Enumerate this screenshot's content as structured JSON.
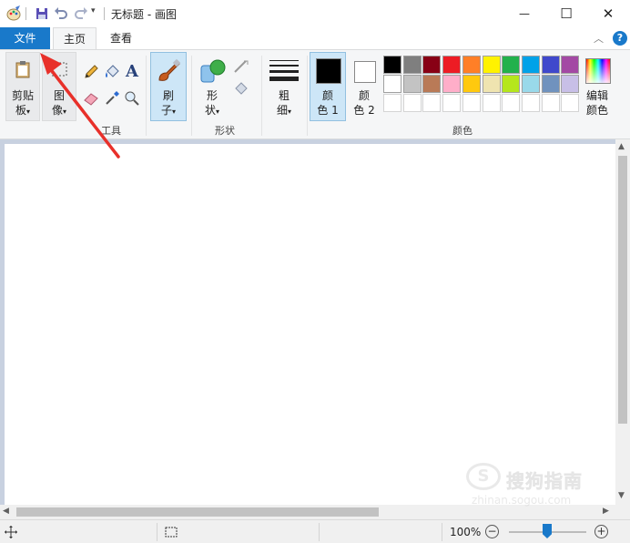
{
  "window": {
    "title": "无标题 - 画图",
    "minimize_glyph": "—",
    "maximize_glyph": "☐",
    "close_glyph": "✕"
  },
  "quick_access": {
    "items": [
      "paint-app-icon",
      "save-icon",
      "undo-icon",
      "redo-icon",
      "customize-dropdown-icon"
    ],
    "dropdown_glyph": "▾"
  },
  "tabs": [
    {
      "label": "文件"
    },
    {
      "label": "主页"
    },
    {
      "label": "查看"
    }
  ],
  "ribbon": {
    "collapse_glyph": "︿",
    "help_glyph": "?",
    "clipboard": {
      "label_1": "剪贴",
      "label_2": "板"
    },
    "image": {
      "label_1": "图",
      "label_2": "像"
    },
    "tools": {
      "group_label": "工具",
      "text_glyph": "A",
      "icons": [
        "pencil-icon",
        "fill-icon",
        "text-icon",
        "eraser-icon",
        "color-picker-icon",
        "magnifier-icon"
      ]
    },
    "brushes": {
      "label_1": "刷",
      "label_2": "子"
    },
    "shapes": {
      "label_1": "形",
      "label_2": "状",
      "group_label": "形状"
    },
    "size": {
      "label_1": "粗",
      "label_2": "细"
    },
    "color1": {
      "label_1": "颜",
      "label_2": "色 1",
      "value": "#000000"
    },
    "color2": {
      "label_1": "颜",
      "label_2": "色 2",
      "value": "#ffffff"
    },
    "colors": {
      "group_label": "颜色",
      "row1": [
        "#000000",
        "#7f7f7f",
        "#880015",
        "#ed1c24",
        "#ff7f27",
        "#fff200",
        "#22b14c",
        "#00a2e8",
        "#3f48cc",
        "#a349a4"
      ],
      "row2": [
        "#ffffff",
        "#c3c3c3",
        "#b97a57",
        "#ffaec9",
        "#ffc90e",
        "#efe4b0",
        "#b5e61d",
        "#99d9ea",
        "#7092be",
        "#c8bfe7"
      ]
    },
    "edit_colors": {
      "label_1": "编辑",
      "label_2": "颜色"
    }
  },
  "scrollbars": {
    "up_glyph": "▲",
    "down_glyph": "▼",
    "left_glyph": "◀",
    "right_glyph": "▶"
  },
  "status": {
    "zoom": "100%",
    "zoom_out_glyph": "−",
    "zoom_in_glyph": "+",
    "zoom_level": 1.0
  },
  "watermark": {
    "logo_glyph": "S",
    "text": "搜狗指南",
    "url": "zhinan.sogou.com"
  },
  "colors": {
    "accent": "#1979ca",
    "annotation_arrow": "#e8302a"
  }
}
